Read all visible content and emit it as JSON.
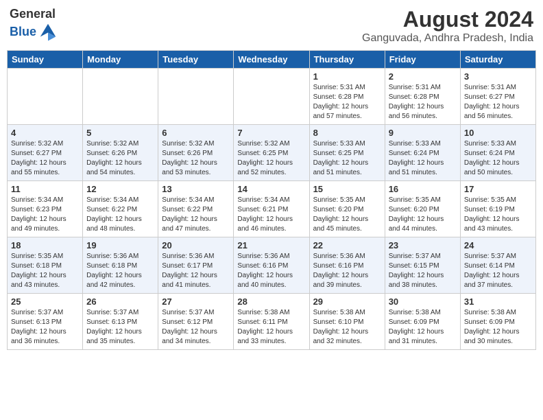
{
  "header": {
    "logo_general": "General",
    "logo_blue": "Blue",
    "title": "August 2024",
    "subtitle": "Ganguvada, Andhra Pradesh, India"
  },
  "calendar": {
    "columns": [
      "Sunday",
      "Monday",
      "Tuesday",
      "Wednesday",
      "Thursday",
      "Friday",
      "Saturday"
    ],
    "weeks": [
      [
        {
          "day": "",
          "info": ""
        },
        {
          "day": "",
          "info": ""
        },
        {
          "day": "",
          "info": ""
        },
        {
          "day": "",
          "info": ""
        },
        {
          "day": "1",
          "info": "Sunrise: 5:31 AM\nSunset: 6:28 PM\nDaylight: 12 hours\nand 57 minutes."
        },
        {
          "day": "2",
          "info": "Sunrise: 5:31 AM\nSunset: 6:28 PM\nDaylight: 12 hours\nand 56 minutes."
        },
        {
          "day": "3",
          "info": "Sunrise: 5:31 AM\nSunset: 6:27 PM\nDaylight: 12 hours\nand 56 minutes."
        }
      ],
      [
        {
          "day": "4",
          "info": "Sunrise: 5:32 AM\nSunset: 6:27 PM\nDaylight: 12 hours\nand 55 minutes."
        },
        {
          "day": "5",
          "info": "Sunrise: 5:32 AM\nSunset: 6:26 PM\nDaylight: 12 hours\nand 54 minutes."
        },
        {
          "day": "6",
          "info": "Sunrise: 5:32 AM\nSunset: 6:26 PM\nDaylight: 12 hours\nand 53 minutes."
        },
        {
          "day": "7",
          "info": "Sunrise: 5:32 AM\nSunset: 6:25 PM\nDaylight: 12 hours\nand 52 minutes."
        },
        {
          "day": "8",
          "info": "Sunrise: 5:33 AM\nSunset: 6:25 PM\nDaylight: 12 hours\nand 51 minutes."
        },
        {
          "day": "9",
          "info": "Sunrise: 5:33 AM\nSunset: 6:24 PM\nDaylight: 12 hours\nand 51 minutes."
        },
        {
          "day": "10",
          "info": "Sunrise: 5:33 AM\nSunset: 6:24 PM\nDaylight: 12 hours\nand 50 minutes."
        }
      ],
      [
        {
          "day": "11",
          "info": "Sunrise: 5:34 AM\nSunset: 6:23 PM\nDaylight: 12 hours\nand 49 minutes."
        },
        {
          "day": "12",
          "info": "Sunrise: 5:34 AM\nSunset: 6:22 PM\nDaylight: 12 hours\nand 48 minutes."
        },
        {
          "day": "13",
          "info": "Sunrise: 5:34 AM\nSunset: 6:22 PM\nDaylight: 12 hours\nand 47 minutes."
        },
        {
          "day": "14",
          "info": "Sunrise: 5:34 AM\nSunset: 6:21 PM\nDaylight: 12 hours\nand 46 minutes."
        },
        {
          "day": "15",
          "info": "Sunrise: 5:35 AM\nSunset: 6:20 PM\nDaylight: 12 hours\nand 45 minutes."
        },
        {
          "day": "16",
          "info": "Sunrise: 5:35 AM\nSunset: 6:20 PM\nDaylight: 12 hours\nand 44 minutes."
        },
        {
          "day": "17",
          "info": "Sunrise: 5:35 AM\nSunset: 6:19 PM\nDaylight: 12 hours\nand 43 minutes."
        }
      ],
      [
        {
          "day": "18",
          "info": "Sunrise: 5:35 AM\nSunset: 6:18 PM\nDaylight: 12 hours\nand 43 minutes."
        },
        {
          "day": "19",
          "info": "Sunrise: 5:36 AM\nSunset: 6:18 PM\nDaylight: 12 hours\nand 42 minutes."
        },
        {
          "day": "20",
          "info": "Sunrise: 5:36 AM\nSunset: 6:17 PM\nDaylight: 12 hours\nand 41 minutes."
        },
        {
          "day": "21",
          "info": "Sunrise: 5:36 AM\nSunset: 6:16 PM\nDaylight: 12 hours\nand 40 minutes."
        },
        {
          "day": "22",
          "info": "Sunrise: 5:36 AM\nSunset: 6:16 PM\nDaylight: 12 hours\nand 39 minutes."
        },
        {
          "day": "23",
          "info": "Sunrise: 5:37 AM\nSunset: 6:15 PM\nDaylight: 12 hours\nand 38 minutes."
        },
        {
          "day": "24",
          "info": "Sunrise: 5:37 AM\nSunset: 6:14 PM\nDaylight: 12 hours\nand 37 minutes."
        }
      ],
      [
        {
          "day": "25",
          "info": "Sunrise: 5:37 AM\nSunset: 6:13 PM\nDaylight: 12 hours\nand 36 minutes."
        },
        {
          "day": "26",
          "info": "Sunrise: 5:37 AM\nSunset: 6:13 PM\nDaylight: 12 hours\nand 35 minutes."
        },
        {
          "day": "27",
          "info": "Sunrise: 5:37 AM\nSunset: 6:12 PM\nDaylight: 12 hours\nand 34 minutes."
        },
        {
          "day": "28",
          "info": "Sunrise: 5:38 AM\nSunset: 6:11 PM\nDaylight: 12 hours\nand 33 minutes."
        },
        {
          "day": "29",
          "info": "Sunrise: 5:38 AM\nSunset: 6:10 PM\nDaylight: 12 hours\nand 32 minutes."
        },
        {
          "day": "30",
          "info": "Sunrise: 5:38 AM\nSunset: 6:09 PM\nDaylight: 12 hours\nand 31 minutes."
        },
        {
          "day": "31",
          "info": "Sunrise: 5:38 AM\nSunset: 6:09 PM\nDaylight: 12 hours\nand 30 minutes."
        }
      ]
    ]
  }
}
